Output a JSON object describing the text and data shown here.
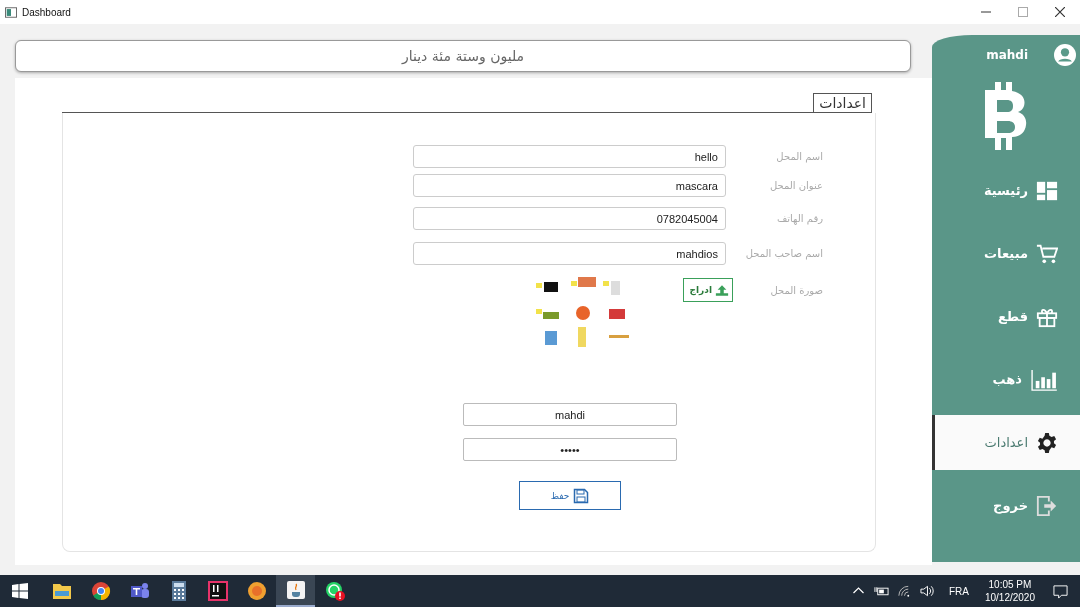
{
  "window": {
    "title": "Dashboard"
  },
  "header": {
    "text": "مليون وستة مئة دينار"
  },
  "settings": {
    "legend": "اعدادات",
    "fields": [
      {
        "label": "اسم المحل",
        "value": "hello"
      },
      {
        "label": "عنوان المحل",
        "value": "mascara"
      },
      {
        "label": "رقم الهاتف",
        "value": "0782045004"
      },
      {
        "label": "اسم صاحب المحل",
        "value": "mahdios"
      }
    ],
    "image": {
      "label": "صورة المحل",
      "button": "ادراج",
      "kind": "picture"
    },
    "username": "mahdi",
    "password": "•••••",
    "save": "حفظ"
  },
  "sidebar": {
    "user": "mahdi",
    "items": [
      {
        "label": "رئيسية",
        "kind": "dashboard",
        "selected": false
      },
      {
        "label": "مبيعات",
        "kind": "cart",
        "selected": false
      },
      {
        "label": "قطع",
        "kind": "gift",
        "selected": false
      },
      {
        "label": "ذهب",
        "kind": "chart",
        "selected": false
      },
      {
        "label": "اعدادات",
        "kind": "gear",
        "selected": true
      },
      {
        "label": "خروج",
        "kind": "exit",
        "selected": false
      }
    ]
  },
  "taskbar": {
    "apps": [
      {
        "kind": "folder",
        "selected": false
      },
      {
        "kind": "chrome",
        "selected": false
      },
      {
        "kind": "teams",
        "selected": false
      },
      {
        "kind": "calculator",
        "selected": false
      },
      {
        "kind": "ide",
        "selected": false
      },
      {
        "kind": "orange",
        "selected": false
      },
      {
        "kind": "java",
        "selected": true
      },
      {
        "kind": "chat",
        "selected": false
      }
    ],
    "language": "FRA",
    "time": "10:05 PM",
    "date": "10/12/2020"
  }
}
